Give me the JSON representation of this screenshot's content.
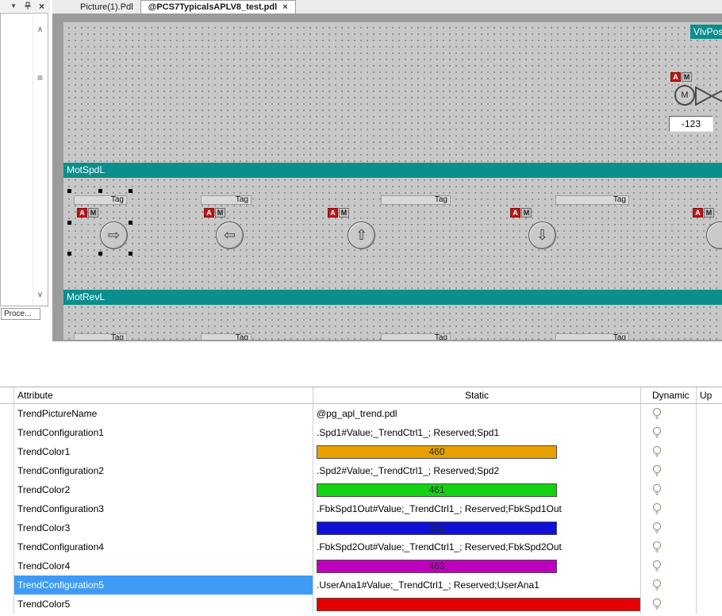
{
  "dock": {
    "tab_label": "Proce...",
    "icons": {
      "dropdown": "▼",
      "close": "×"
    },
    "scrollbar": {
      "up": "∧",
      "grip": "≡",
      "down": "∨"
    }
  },
  "tabs": {
    "tab1": {
      "label": "Picture(1).Pdl"
    },
    "tab2": {
      "label": "@PCS7TypicalsAPLV8_test.pdl",
      "close": "×"
    }
  },
  "canvas": {
    "vlv_pos_label": "VlvPosL.",
    "mot_spd_label": "MotSpdL",
    "mot_rev_label": "MotRevL",
    "io_value": "-123",
    "valve_motor_letter": "M",
    "badge_a": "A",
    "badge_m": "M",
    "tag_caption": "Tag",
    "arrow_right": "⇨",
    "arrow_left": "⇦",
    "arrow_up": "⇧",
    "arrow_down": "⇩"
  },
  "properties": {
    "columns": {
      "attribute": "Attribute",
      "static": "Static",
      "dynamic": "Dynamic",
      "update": "Up"
    },
    "rows": [
      {
        "attribute": "TrendPictureName",
        "static": "@pg_apl_trend.pdl"
      },
      {
        "attribute": "TrendConfiguration1",
        "static": ".Spd1#Value;_TrendCtrl1_; Reserved;Spd1"
      },
      {
        "attribute": "TrendColor1",
        "color": "#E8A000",
        "value": "460"
      },
      {
        "attribute": "TrendConfiguration2",
        "static": ".Spd2#Value;_TrendCtrl1_; Reserved;Spd2"
      },
      {
        "attribute": "TrendColor2",
        "color": "#12D312",
        "value": "461"
      },
      {
        "attribute": "TrendConfiguration3",
        "static": ".FbkSpd1Out#Value;_TrendCtrl1_; Reserved;FbkSpd1Out"
      },
      {
        "attribute": "TrendColor3",
        "color": "#1010D8",
        "value": "462"
      },
      {
        "attribute": "TrendConfiguration4",
        "static": ".FbkSpd2Out#Value;_TrendCtrl1_; Reserved;FbkSpd2Out"
      },
      {
        "attribute": "TrendColor4",
        "color": "#BE00BE",
        "value": "463"
      },
      {
        "attribute": "TrendConfiguration5",
        "static": ".UserAna1#Value;_TrendCtrl1_; Reserved;UserAna1",
        "selected": true
      },
      {
        "attribute": "TrendColor5",
        "color": "#E60000",
        "value": ""
      }
    ]
  }
}
